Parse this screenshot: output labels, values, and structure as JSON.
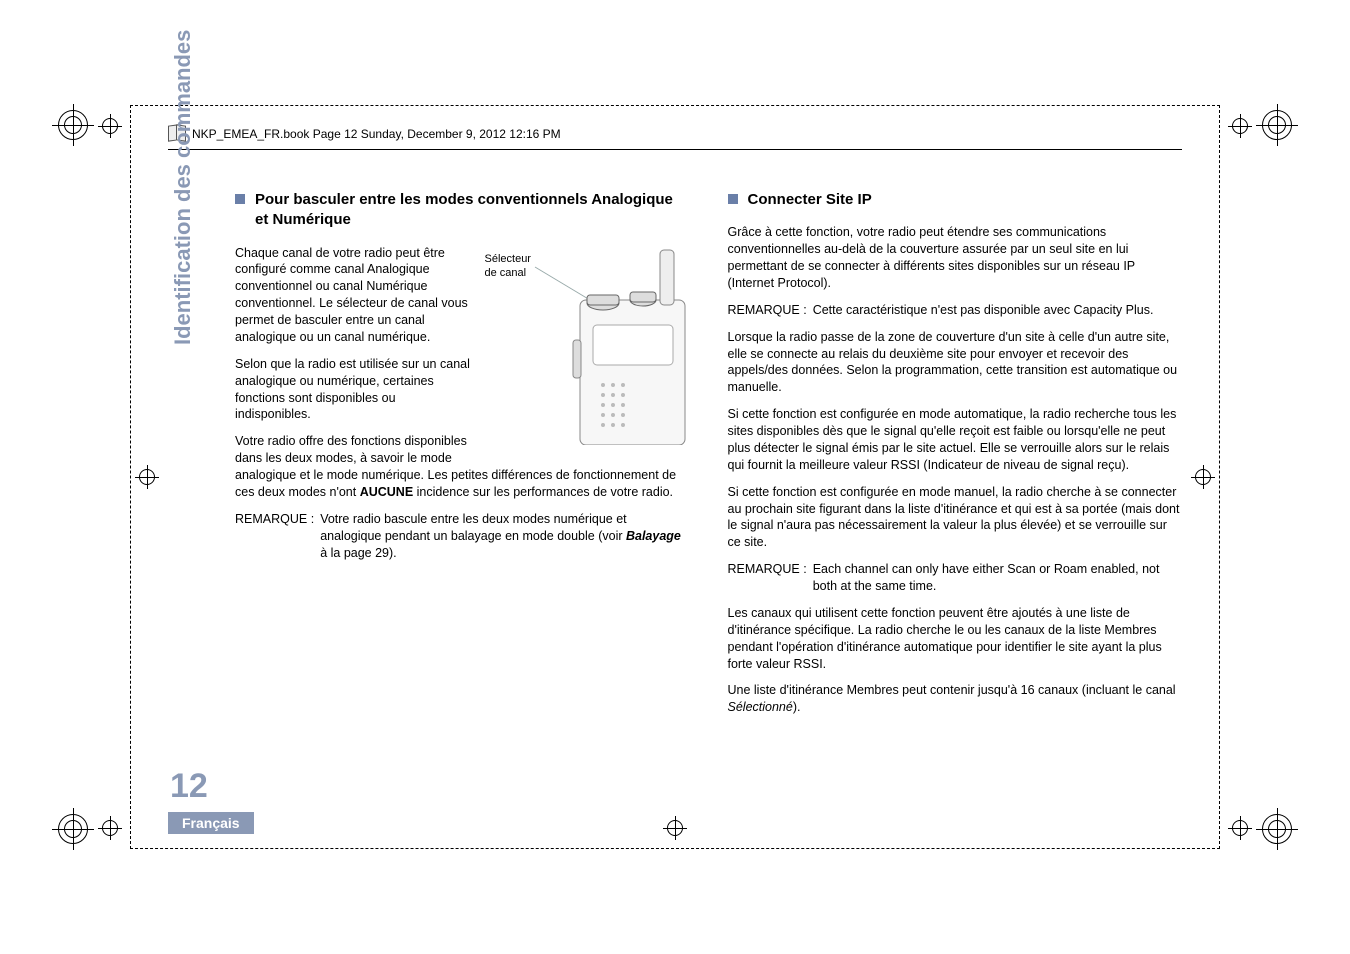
{
  "header": {
    "filename_line": "NKP_EMEA_FR.book  Page 12  Sunday, December 9, 2012  12:16 PM"
  },
  "sidebar": {
    "tab_text": "Identification des commandes",
    "page_number": "12",
    "language": "Français"
  },
  "left": {
    "title": "Pour basculer entre les modes conventionnels Analogique et Numérique",
    "figure_label_l1": "Sélecteur",
    "figure_label_l2": "de canal",
    "para1": "Chaque canal de votre radio peut être configuré comme canal Analogique conventionnel ou canal Numérique conventionnel. Le sélecteur de canal vous permet de basculer entre un canal analogique ou un canal numérique.",
    "para2": "Selon que la radio est utilisée sur un canal analogique ou numérique, certaines fonctions sont disponibles ou indisponibles.",
    "para3_pre": "Votre radio offre des fonctions disponibles dans les deux modes, à savoir le mode analogique et le mode numérique. Les petites différences de fonctionnement de ces deux modes n'ont ",
    "para3_bold": "AUCUNE",
    "para3_post": " incidence sur les performances de votre radio.",
    "remarque_label": "REMARQUE :",
    "remarque_text_pre": "Votre radio bascule entre les deux modes numérique et analogique pendant un balayage en mode double (voir ",
    "remarque_text_italic": "Balayage",
    "remarque_text_post": " à la page 29)."
  },
  "right": {
    "title": "Connecter Site IP",
    "para1": "Grâce à cette fonction, votre radio peut étendre ses communications conventionnelles au-delà de la couverture assurée par un seul site en lui permettant de se connecter à différents sites disponibles sur un réseau IP (Internet Protocol).",
    "remarque1_label": "REMARQUE :",
    "remarque1_text": "Cette caractéristique n'est pas disponible avec Capacity Plus.",
    "para2": "Lorsque la radio passe de la zone de couverture d'un site à celle d'un autre site, elle se connecte au relais du deuxième site pour envoyer et recevoir des appels/des données. Selon la programmation, cette transition est automatique ou manuelle.",
    "para3": "Si cette fonction est configurée en mode automatique, la radio recherche tous les sites disponibles dès que le signal qu'elle reçoit est faible ou lorsqu'elle ne peut plus détecter le signal émis par le site actuel. Elle se verrouille alors sur le relais qui fournit la meilleure valeur RSSI (Indicateur de niveau de signal reçu).",
    "para4": "Si cette fonction est configurée en mode manuel, la radio cherche à se connecter au prochain site figurant dans la liste d'itinérance et qui est à sa portée (mais dont le signal n'aura pas nécessairement la valeur la plus élevée) et se verrouille sur ce site.",
    "remarque2_label": "REMARQUE :",
    "remarque2_text": "Each channel can only have either Scan or Roam enabled, not both at the same time.",
    "para5": "Les canaux qui utilisent cette fonction peuvent être ajoutés à une liste de d'itinérance spécifique. La radio cherche le ou les canaux de la liste Membres pendant l'opération d'itinérance automatique pour identifier le site ayant la plus forte valeur RSSI.",
    "para6_pre": "Une liste d'itinérance Membres peut contenir jusqu'à 16 canaux (incluant le canal ",
    "para6_italic": "Sélectionné",
    "para6_post": ")."
  }
}
